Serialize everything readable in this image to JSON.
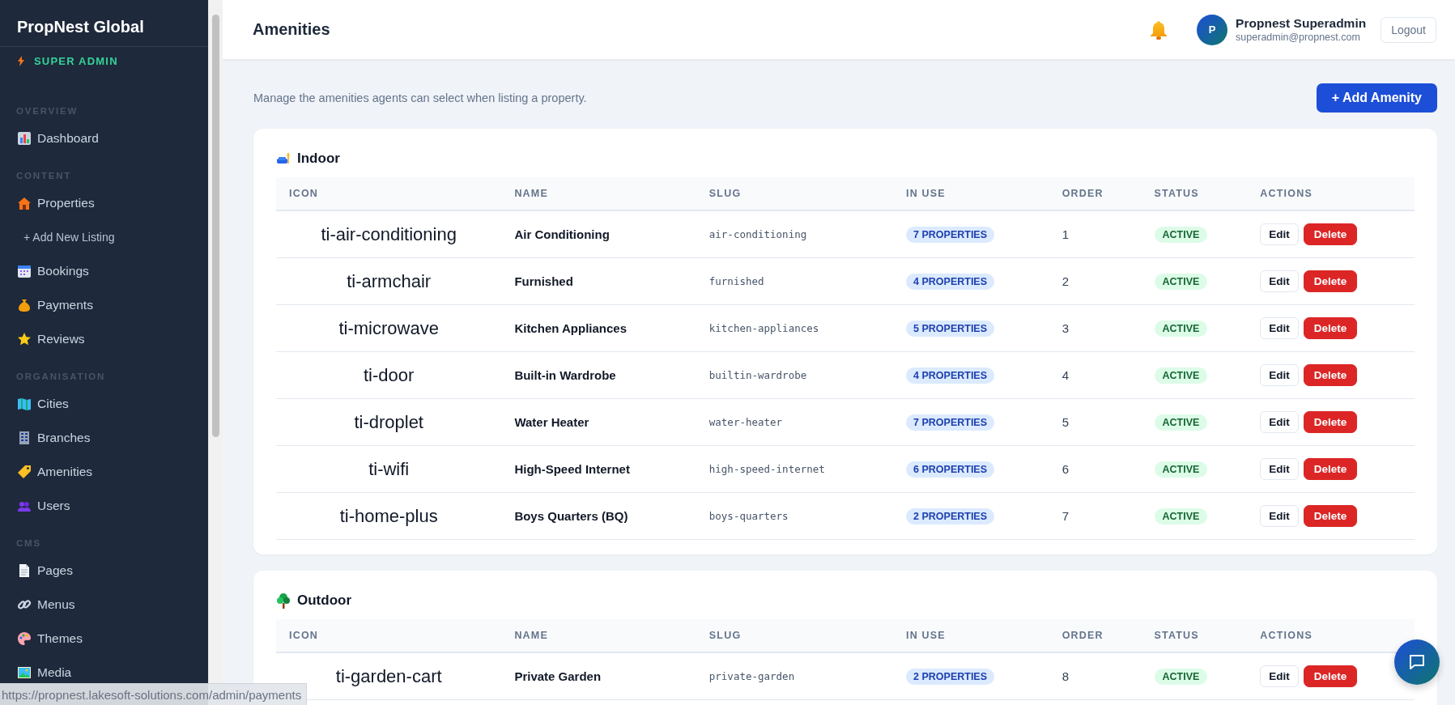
{
  "sidebar": {
    "brand": "PropNest Global",
    "role": "SUPER ADMIN",
    "sections": [
      {
        "label": "OVERVIEW",
        "items": [
          {
            "label": "Dashboard",
            "kind": "main"
          }
        ]
      },
      {
        "label": "CONTENT",
        "items": [
          {
            "label": "Properties",
            "kind": "main"
          },
          {
            "label": "+ Add New Listing",
            "kind": "sub"
          },
          {
            "label": "Bookings",
            "kind": "main"
          },
          {
            "label": "Payments",
            "kind": "main"
          },
          {
            "label": "Reviews",
            "kind": "main"
          }
        ]
      },
      {
        "label": "ORGANISATION",
        "items": [
          {
            "label": "Cities",
            "kind": "main"
          },
          {
            "label": "Branches",
            "kind": "main"
          },
          {
            "label": "Amenities",
            "kind": "main"
          },
          {
            "label": "Users",
            "kind": "main"
          }
        ]
      },
      {
        "label": "CMS",
        "items": [
          {
            "label": "Pages",
            "kind": "main"
          },
          {
            "label": "Menus",
            "kind": "main"
          },
          {
            "label": "Themes",
            "kind": "main"
          },
          {
            "label": "Media",
            "kind": "main"
          }
        ]
      }
    ]
  },
  "header": {
    "title": "Amenities",
    "user": {
      "initial": "P",
      "name": "Propnest Superadmin",
      "email": "superadmin@propnest.com"
    },
    "logout": "Logout"
  },
  "intro": "Manage the amenities agents can select when listing a property.",
  "add_button": "+ Add Amenity",
  "categories": [
    {
      "title": "Indoor",
      "columns": [
        "ICON",
        "NAME",
        "SLUG",
        "IN USE",
        "ORDER",
        "STATUS",
        "ACTIONS"
      ],
      "rows": [
        {
          "icon_class": "ti-air-conditioning",
          "name": "Air Conditioning",
          "slug": "air-conditioning",
          "in_use": "7 PROPERTIES",
          "order": "1",
          "status": "ACTIVE",
          "actions": [
            {
              "label": "Edit",
              "kind": "edit"
            },
            {
              "label": "Delete",
              "kind": "delete"
            }
          ]
        },
        {
          "icon_class": "ti-armchair",
          "name": "Furnished",
          "slug": "furnished",
          "in_use": "4 PROPERTIES",
          "order": "2",
          "status": "ACTIVE",
          "actions": [
            {
              "label": "Edit",
              "kind": "edit"
            },
            {
              "label": "Delete",
              "kind": "delete"
            }
          ]
        },
        {
          "icon_class": "ti-microwave",
          "name": "Kitchen Appliances",
          "slug": "kitchen-appliances",
          "in_use": "5 PROPERTIES",
          "order": "3",
          "status": "ACTIVE",
          "actions": [
            {
              "label": "Edit",
              "kind": "edit"
            },
            {
              "label": "Delete",
              "kind": "delete"
            }
          ]
        },
        {
          "icon_class": "ti-door",
          "name": "Built-in Wardrobe",
          "slug": "builtin-wardrobe",
          "in_use": "4 PROPERTIES",
          "order": "4",
          "status": "ACTIVE",
          "actions": [
            {
              "label": "Edit",
              "kind": "edit"
            },
            {
              "label": "Delete",
              "kind": "delete"
            }
          ]
        },
        {
          "icon_class": "ti-droplet",
          "name": "Water Heater",
          "slug": "water-heater",
          "in_use": "7 PROPERTIES",
          "order": "5",
          "status": "ACTIVE",
          "actions": [
            {
              "label": "Edit",
              "kind": "edit"
            },
            {
              "label": "Delete",
              "kind": "delete"
            }
          ]
        },
        {
          "icon_class": "ti-wifi",
          "name": "High-Speed Internet",
          "slug": "high-speed-internet",
          "in_use": "6 PROPERTIES",
          "order": "6",
          "status": "ACTIVE",
          "actions": [
            {
              "label": "Edit",
              "kind": "edit"
            },
            {
              "label": "Delete",
              "kind": "delete"
            }
          ]
        },
        {
          "icon_class": "ti-home-plus",
          "name": "Boys Quarters (BQ)",
          "slug": "boys-quarters",
          "in_use": "2 PROPERTIES",
          "order": "7",
          "status": "ACTIVE",
          "actions": [
            {
              "label": "Edit",
              "kind": "edit"
            },
            {
              "label": "Delete",
              "kind": "delete"
            }
          ]
        }
      ]
    },
    {
      "title": "Outdoor",
      "columns": [
        "ICON",
        "NAME",
        "SLUG",
        "IN USE",
        "ORDER",
        "STATUS",
        "ACTIONS"
      ],
      "rows": [
        {
          "icon_class": "ti-garden-cart",
          "name": "Private Garden",
          "slug": "private-garden",
          "in_use": "2 PROPERTIES",
          "order": "8",
          "status": "ACTIVE",
          "actions": [
            {
              "label": "Edit",
              "kind": "edit"
            },
            {
              "label": "Delete",
              "kind": "delete"
            }
          ]
        }
      ]
    }
  ],
  "status_url": "https://propnest.lakesoft-solutions.com/admin/payments"
}
